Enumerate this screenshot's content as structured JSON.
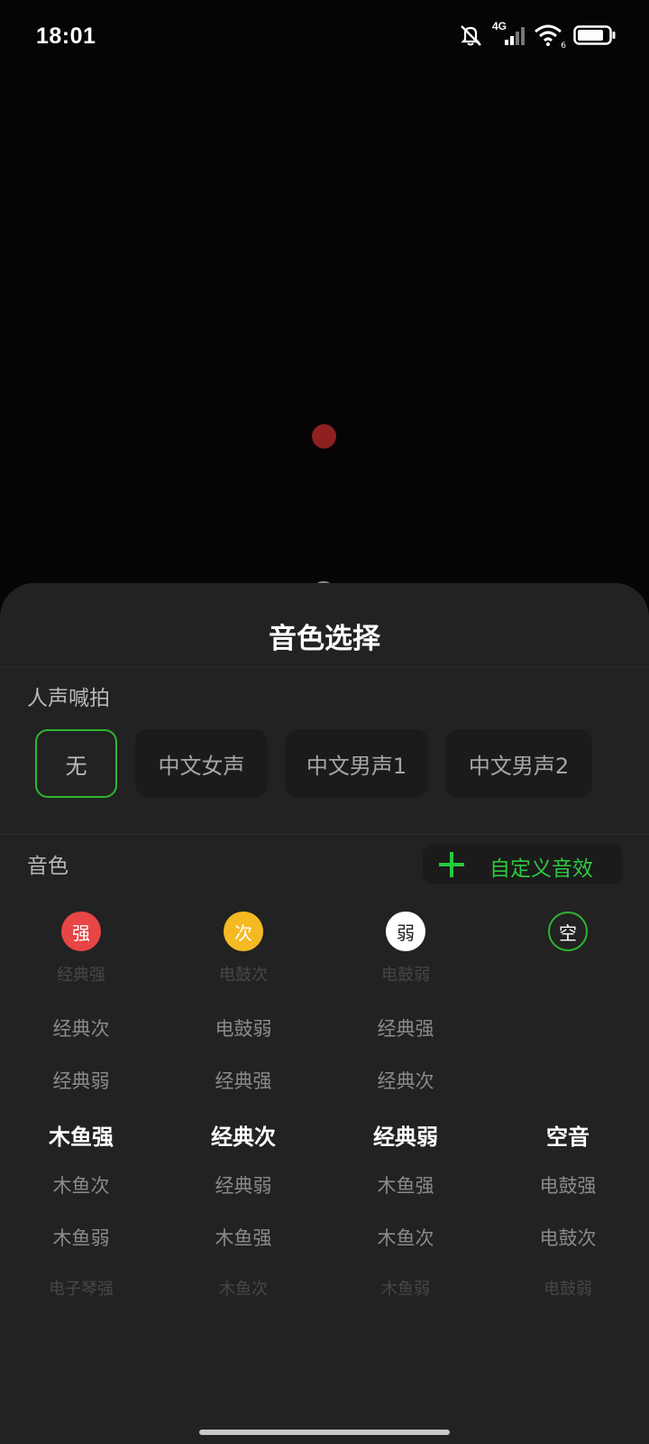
{
  "status_bar": {
    "time": "18:01",
    "network": "4G",
    "wifi_level": "6"
  },
  "sheet": {
    "title": "音色选择",
    "voice_section_label": "人声喊拍",
    "voice_options": [
      {
        "label": "无",
        "selected": true
      },
      {
        "label": "中文女声",
        "selected": false
      },
      {
        "label": "中文男声1",
        "selected": false
      },
      {
        "label": "中文男声2",
        "selected": false
      }
    ],
    "tone_section_label": "音色",
    "custom_button_label": "自定义音效",
    "tone_badges": [
      {
        "label": "强",
        "color": "#e84545"
      },
      {
        "label": "次",
        "color": "#f5b922"
      },
      {
        "label": "弱",
        "color": "#ffffff"
      },
      {
        "label": "空",
        "color": "#2fb52f"
      }
    ],
    "wheel_columns": [
      {
        "items": [
          "经典强",
          "经典次",
          "经典弱",
          "木鱼强",
          "木鱼次",
          "木鱼弱",
          "电子琴强"
        ],
        "selected_index": 3
      },
      {
        "items": [
          "电鼓次",
          "电鼓弱",
          "经典强",
          "经典次",
          "经典弱",
          "木鱼强",
          "木鱼次"
        ],
        "selected_index": 3
      },
      {
        "items": [
          "电鼓弱",
          "经典强",
          "经典次",
          "经典弱",
          "木鱼强",
          "木鱼次",
          "木鱼弱"
        ],
        "selected_index": 3
      },
      {
        "items": [
          "",
          "",
          "",
          "空音",
          "电鼓强",
          "电鼓次",
          "电鼓弱"
        ],
        "selected_index": 3
      }
    ]
  },
  "colors": {
    "accent": "#2fb52f",
    "sheet_bg": "#222222",
    "recording_dot": "#8e2020"
  }
}
